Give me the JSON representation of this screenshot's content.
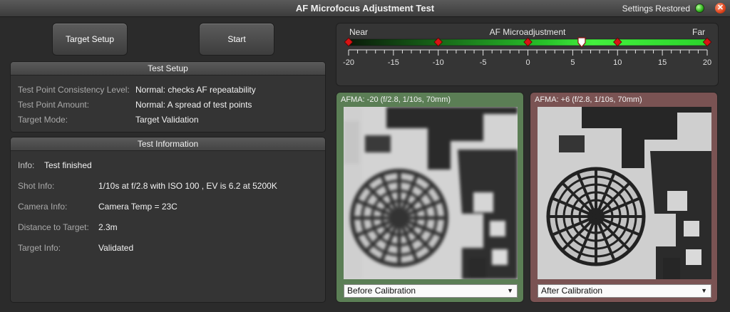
{
  "window": {
    "title": "AF Microfocus Adjustment Test",
    "status_text": "Settings Restored",
    "status_color": "#2fb21c",
    "close_symbol": "✕"
  },
  "toolbar": {
    "target_setup_label": "Target Setup",
    "start_label": "Start"
  },
  "test_setup": {
    "header": "Test Setup",
    "rows": [
      {
        "label": "Test Point Consistency Level:",
        "value": "Normal: checks AF repeatability"
      },
      {
        "label": "Test Point Amount:",
        "value": "Normal: A spread of test points"
      },
      {
        "label": "Target Mode:",
        "value": "Target Validation"
      }
    ]
  },
  "test_information": {
    "header": "Test Information",
    "rows": [
      {
        "label": "Info:",
        "value": "Test finished"
      },
      {
        "label": "Shot Info:",
        "value": "1/10s at f/2.8 with ISO 100 , EV is 6.2 at 5200K"
      },
      {
        "label": "Camera Info:",
        "value": "Camera Temp = 23C"
      },
      {
        "label": "Distance to Target:",
        "value": "2.3m"
      },
      {
        "label": "Target Info:",
        "value": "Validated"
      }
    ]
  },
  "afma_scale": {
    "title": "AF Microadjustment",
    "left_label": "Near",
    "right_label": "Far",
    "min": -20,
    "max": 20,
    "tick_labels": [
      "-20",
      "-15",
      "-10",
      "-5",
      "0",
      "5",
      "10",
      "15",
      "20"
    ],
    "test_markers": [
      -20,
      -10,
      0,
      10,
      20
    ],
    "current_value": 6,
    "marker_color": "#d81414"
  },
  "before": {
    "caption": "AFMA: -20 (f/2.8, 1/10s, 70mm)",
    "select_value": "Before Calibration",
    "frame_color": "#5b7e55"
  },
  "after": {
    "caption": "AFMA: +6 (f/2.8, 1/10s, 70mm)",
    "select_value": "After Calibration",
    "frame_color": "#7a5353"
  }
}
